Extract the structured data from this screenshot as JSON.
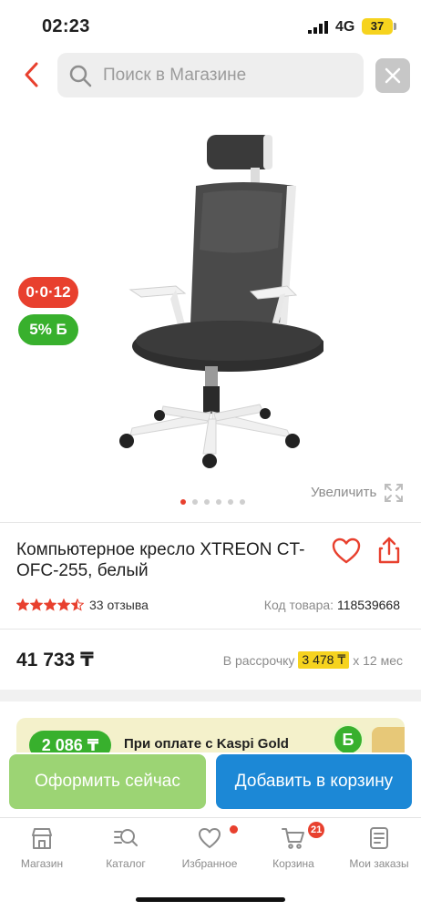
{
  "status_bar": {
    "time": "02:23",
    "network": "4G",
    "battery": "37"
  },
  "search": {
    "placeholder": "Поиск в Магазине",
    "value": ""
  },
  "product": {
    "badges": {
      "installment": "0·0·12",
      "bonus": "5% Б"
    },
    "image_pages": 6,
    "active_page": 1,
    "zoom_label": "Увеличить",
    "title": "Компьютерное кресло XTREON CT-OFC-255, белый",
    "rating": 4.5,
    "reviews": "33 отзыва",
    "code_label": "Код товара:",
    "code": "118539668",
    "price": "41 733 ₸",
    "installment": {
      "prefix": "В рассрочку",
      "amount": "3 478 ₸",
      "suffix": "х 12 мес"
    }
  },
  "promo": {
    "bonus_amount": "2 086 ₸",
    "text": "При оплате с Kaspi Gold",
    "icon_letter": "Б"
  },
  "actions": {
    "order_now": "Оформить сейчас",
    "add_to_cart": "Добавить в корзину"
  },
  "nav": {
    "items": [
      {
        "label": "Магазин",
        "icon": "shop-icon"
      },
      {
        "label": "Каталог",
        "icon": "catalog-search-icon"
      },
      {
        "label": "Избранное",
        "icon": "heart-icon"
      },
      {
        "label": "Корзина",
        "icon": "cart-icon",
        "count": "21"
      },
      {
        "label": "Мои заказы",
        "icon": "orders-icon"
      }
    ]
  },
  "colors": {
    "accent_red": "#e8402e",
    "green": "#38b02d",
    "blue": "#1c88d6",
    "light_green": "#9cd474",
    "yellow": "#f6d31e"
  }
}
